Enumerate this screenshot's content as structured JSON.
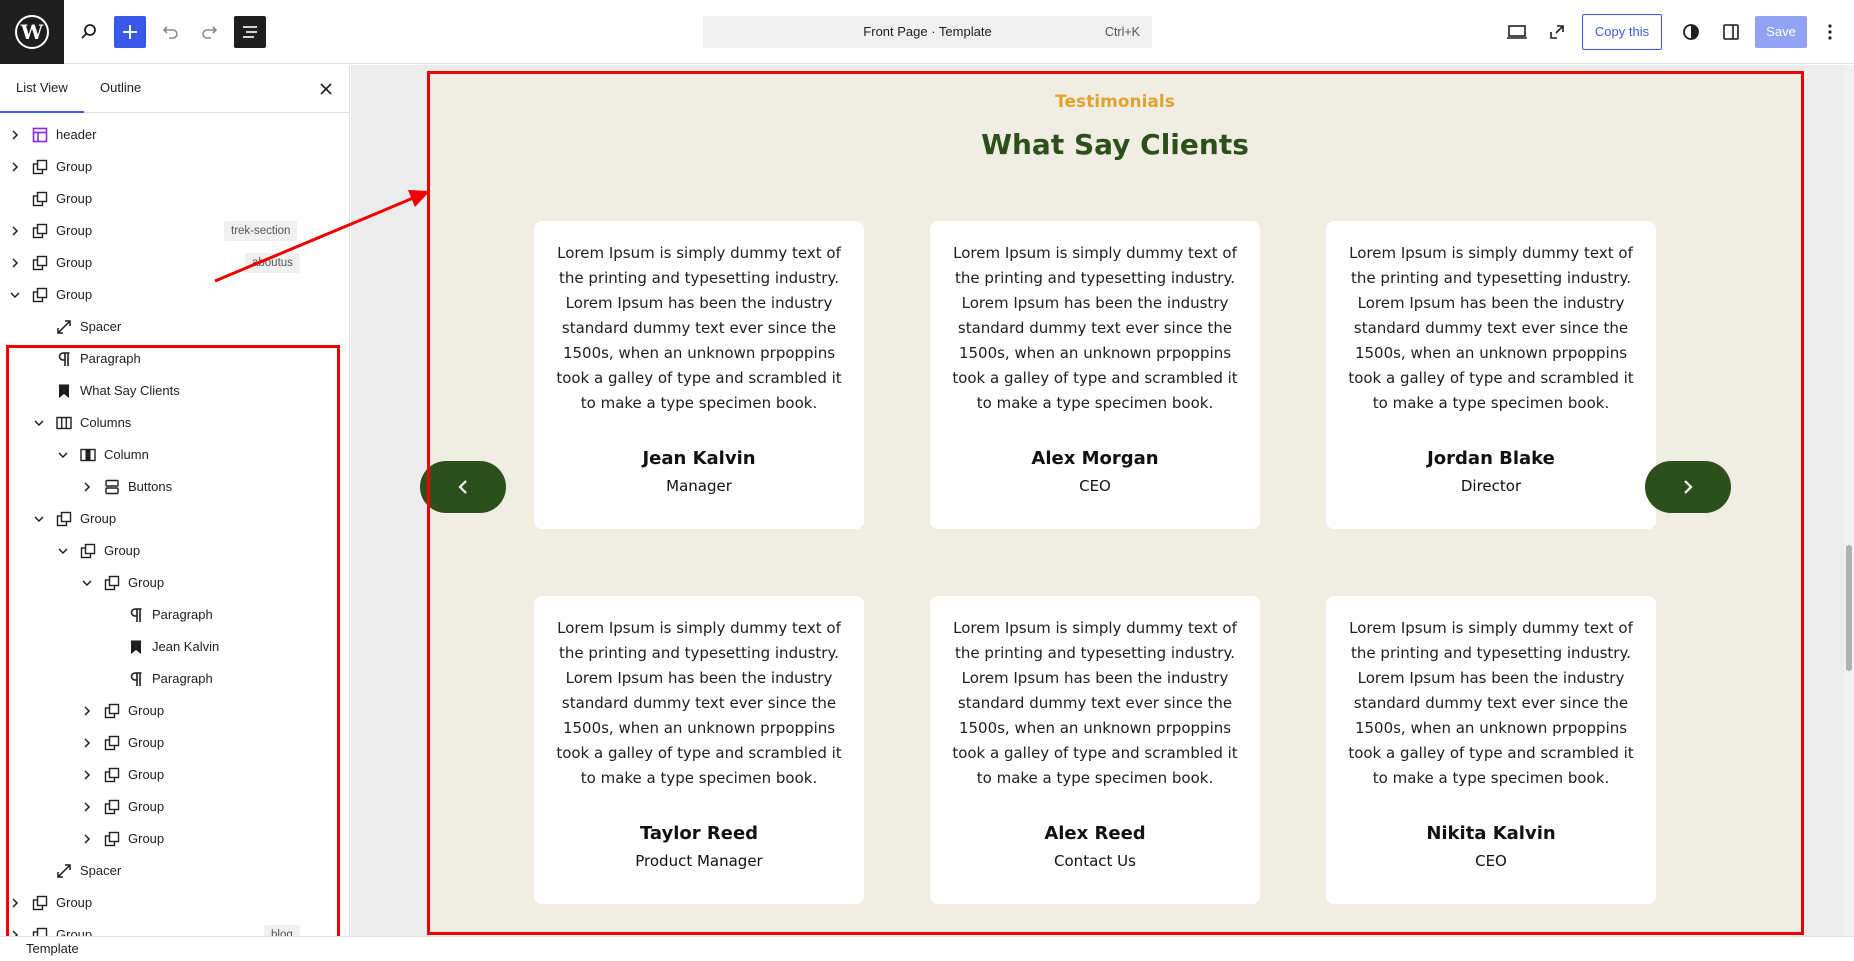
{
  "topbar": {
    "command_title": "Front Page · Template",
    "command_shortcut": "Ctrl+K",
    "copy_label": "Copy this",
    "save_label": "Save",
    "colors": {
      "accent": "#3858e9",
      "dark": "#1e1e1e"
    }
  },
  "sidebar": {
    "tabs": [
      {
        "label": "List View"
      },
      {
        "label": "Outline"
      }
    ],
    "rows": [
      {
        "label": "header",
        "badge": ""
      },
      {
        "label": "Group",
        "badge": ""
      },
      {
        "label": "Group",
        "badge": ""
      },
      {
        "label": "Group",
        "badge": "trek-section"
      },
      {
        "label": "Group",
        "badge": "aboutus"
      },
      {
        "label": "Group",
        "badge": ""
      },
      {
        "label": "Spacer",
        "badge": ""
      },
      {
        "label": "Paragraph",
        "badge": ""
      },
      {
        "label": "What Say Clients",
        "badge": ""
      },
      {
        "label": "Columns",
        "badge": ""
      },
      {
        "label": "Column",
        "badge": ""
      },
      {
        "label": "Buttons",
        "badge": ""
      },
      {
        "label": "Group",
        "badge": ""
      },
      {
        "label": "Group",
        "badge": ""
      },
      {
        "label": "Group",
        "badge": ""
      },
      {
        "label": "Paragraph",
        "badge": ""
      },
      {
        "label": "Jean Kalvin",
        "badge": ""
      },
      {
        "label": "Paragraph",
        "badge": ""
      },
      {
        "label": "Group",
        "badge": ""
      },
      {
        "label": "Group",
        "badge": ""
      },
      {
        "label": "Group",
        "badge": ""
      },
      {
        "label": "Group",
        "badge": ""
      },
      {
        "label": "Group",
        "badge": ""
      },
      {
        "label": "Spacer",
        "badge": ""
      },
      {
        "label": "Group",
        "badge": ""
      },
      {
        "label": "Group",
        "badge": "blog"
      }
    ]
  },
  "canvas": {
    "eyebrow": "Testimonials",
    "heading": "What Say Clients",
    "colors": {
      "eyebrow": "#e2a32e",
      "heading": "#2c4f1c",
      "background": "#f0ede2",
      "arrow": "#2c4f1c"
    },
    "cards": [
      {
        "text": "Lorem Ipsum is simply dummy text of the printing and typesetting industry. Lorem Ipsum has been the industry standard dummy text ever since the 1500s, when an unknown prpoppins took a galley of type and scrambled it to make a type specimen book.",
        "name": "Jean Kalvin",
        "role": "Manager"
      },
      {
        "text": "Lorem Ipsum is simply dummy text of the printing and typesetting industry. Lorem Ipsum has been the industry standard dummy text ever since the 1500s, when an unknown prpoppins took a galley of type and scrambled it to make a type specimen book.",
        "name": "Alex Morgan",
        "role": "CEO"
      },
      {
        "text": "Lorem Ipsum is simply dummy text of the printing and typesetting industry. Lorem Ipsum has been the industry standard dummy text ever since the 1500s, when an unknown prpoppins took a galley of type and scrambled it to make a type specimen book.",
        "name": "Jordan Blake",
        "role": "Director"
      },
      {
        "text": "Lorem Ipsum is simply dummy text of the printing and typesetting industry. Lorem Ipsum has been the industry standard dummy text ever since the 1500s, when an unknown prpoppins took a galley of type and scrambled it to make a type specimen book.",
        "name": "Taylor Reed",
        "role": "Product Manager"
      },
      {
        "text": "Lorem Ipsum is simply dummy text of the printing and typesetting industry. Lorem Ipsum has been the industry standard dummy text ever since the 1500s, when an unknown prpoppins took a galley of type and scrambled it to make a type specimen book.",
        "name": "Alex Reed",
        "role": "Contact Us"
      },
      {
        "text": "Lorem Ipsum is simply dummy text of the printing and typesetting industry. Lorem Ipsum has been the industry standard dummy text ever since the 1500s, when an unknown prpoppins took a galley of type and scrambled it to make a type specimen book.",
        "name": "Nikita Kalvin",
        "role": "CEO"
      }
    ]
  },
  "footer": {
    "label": "Template"
  }
}
